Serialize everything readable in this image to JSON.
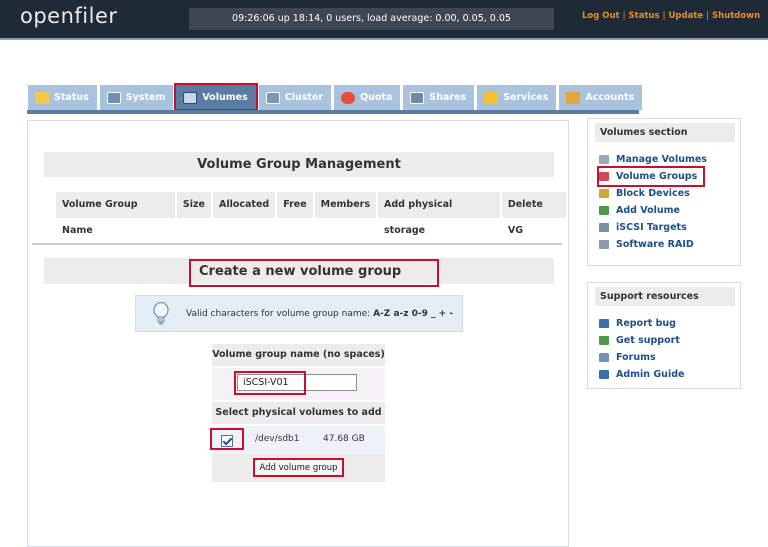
{
  "app": {
    "logo": "openfiler",
    "status_text": "09:26:06 up 18:14, 0 users, load average: 0.00, 0.05, 0.05",
    "top_links": [
      "Log Out",
      "Status",
      "Update",
      "Shutdown"
    ]
  },
  "tabs": [
    {
      "label": "Status",
      "icon": "status-icon"
    },
    {
      "label": "System",
      "icon": "system-icon"
    },
    {
      "label": "Volumes",
      "icon": "volumes-icon",
      "active": true
    },
    {
      "label": "Cluster",
      "icon": "cluster-icon"
    },
    {
      "label": "Quota",
      "icon": "quota-icon"
    },
    {
      "label": "Shares",
      "icon": "shares-icon"
    },
    {
      "label": "Services",
      "icon": "services-icon"
    },
    {
      "label": "Accounts",
      "icon": "accounts-icon"
    }
  ],
  "main": {
    "vg_title": "Volume Group Management",
    "vg_columns": [
      "Volume Group Name",
      "Size",
      "Allocated",
      "Free",
      "Members",
      "Add physical storage",
      "Delete VG"
    ],
    "create_title": "Create a new volume group",
    "info_text": "Valid characters for volume group name:",
    "info_chars": "A-Z a-z 0-9 _ + -",
    "name_label": "Volume group name (no spaces)",
    "name_value": "iSCSI-V01",
    "pv_label": "Select physical volumes to add",
    "pv_device": "/dev/sdb1",
    "pv_size": "47.68 GB",
    "pv_checked": true,
    "submit_label": "Add volume group"
  },
  "sidebar": {
    "volumes_title": "Volumes section",
    "volumes_items": [
      "Manage Volumes",
      "Volume Groups",
      "Block Devices",
      "Add Volume",
      "iSCSI Targets",
      "Software RAID"
    ],
    "support_title": "Support resources",
    "support_items": [
      "Report bug",
      "Get support",
      "Forums",
      "Admin Guide"
    ]
  },
  "colors": {
    "header_bg": "#1e2a36",
    "link_orange": "#f08a1e",
    "tab_bg": "#a9c2de",
    "tab_active": "#5a7ca3",
    "highlight_red": "#c8102e",
    "sidebar_link": "#1d4f8a"
  }
}
